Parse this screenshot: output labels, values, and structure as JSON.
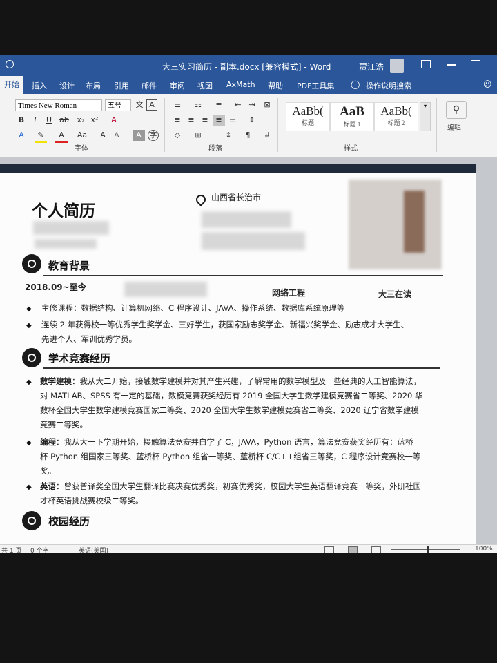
{
  "window": {
    "title": "大三实习简历 - 副本.docx [兼容模式] - Word",
    "user": "贾江浩"
  },
  "ribbon_tabs": [
    "开始",
    "插入",
    "设计",
    "布局",
    "引用",
    "邮件",
    "审阅",
    "视图",
    "AxMath",
    "帮助",
    "PDF工具集",
    "操作说明搜索"
  ],
  "font_group": {
    "font_name": "Times New Roman",
    "font_size": "五号",
    "label": "字体"
  },
  "paragraph_group": {
    "label": "段落"
  },
  "styles_group": {
    "label": "样式",
    "styles": [
      {
        "sample": "AaBb(",
        "name": "标题"
      },
      {
        "sample": "AaB",
        "name": "标题 1"
      },
      {
        "sample": "AaBb(",
        "name": "标题 2"
      }
    ]
  },
  "editing_group": {
    "label": "编辑"
  },
  "resume": {
    "title": "个人简历",
    "location": "山西省长治市",
    "sections": {
      "education": "教育背景",
      "competitions": "学术竞赛经历",
      "campus": "校园经历"
    },
    "education": {
      "date": "2018.09~至今",
      "major": "网络工程",
      "status": "大三在读",
      "courses": "主修课程：数据结构、计算机网络、C 程序设计、JAVA、操作系统、数据库系统原理等",
      "awards_line1": "连续 2 年获得校一等优秀学生奖学金、三好学生，获国家励志奖学金、新福兴奖学金、励志成才大学生、",
      "awards_line2": "先进个人、军训优秀学员。"
    },
    "competitions": [
      {
        "label": "数学建模",
        "lines": [
          "：我从大二开始，接触数学建模并对其产生兴趣，了解常用的数学模型及一些经典的人工智能算法，",
          "对 MATLAB、SPSS 有一定的基础，数模竞赛获奖经历有 2019 全国大学生数学建模竞赛省二等奖、2020 华",
          "数杯全国大学生数学建模竞赛国家二等奖、2020 全国大学生数学建模竞赛省二等奖、2020 辽宁省数学建模",
          "竞赛二等奖。"
        ]
      },
      {
        "label": "编程",
        "lines": [
          "：我从大一下学期开始，接触算法竞赛并自学了 C，JAVA，Python 语言，算法竞赛获奖经历有：蓝桥",
          "杯 Python 组国家三等奖、蓝桥杯 Python 组省一等奖、蓝桥杯 C/C++组省三等奖，C 程序设计竞赛校一等",
          "奖。"
        ]
      },
      {
        "label": "英语",
        "lines": [
          "：曾获普译奖全国大学生翻译比赛决赛优秀奖，初赛优秀奖，校园大学生英语翻译竞赛一等奖，外研社国",
          "才杯英语挑战赛校级二等奖。"
        ]
      }
    ]
  },
  "status_bar": {
    "page": "共 1 页",
    "words": "0 个字",
    "language": "英语(美国)",
    "zoom": "100%"
  },
  "colors": {
    "word_blue": "#2b579a",
    "page_bar": "#1f2b3a",
    "taskbar": "#1d2b3a"
  }
}
